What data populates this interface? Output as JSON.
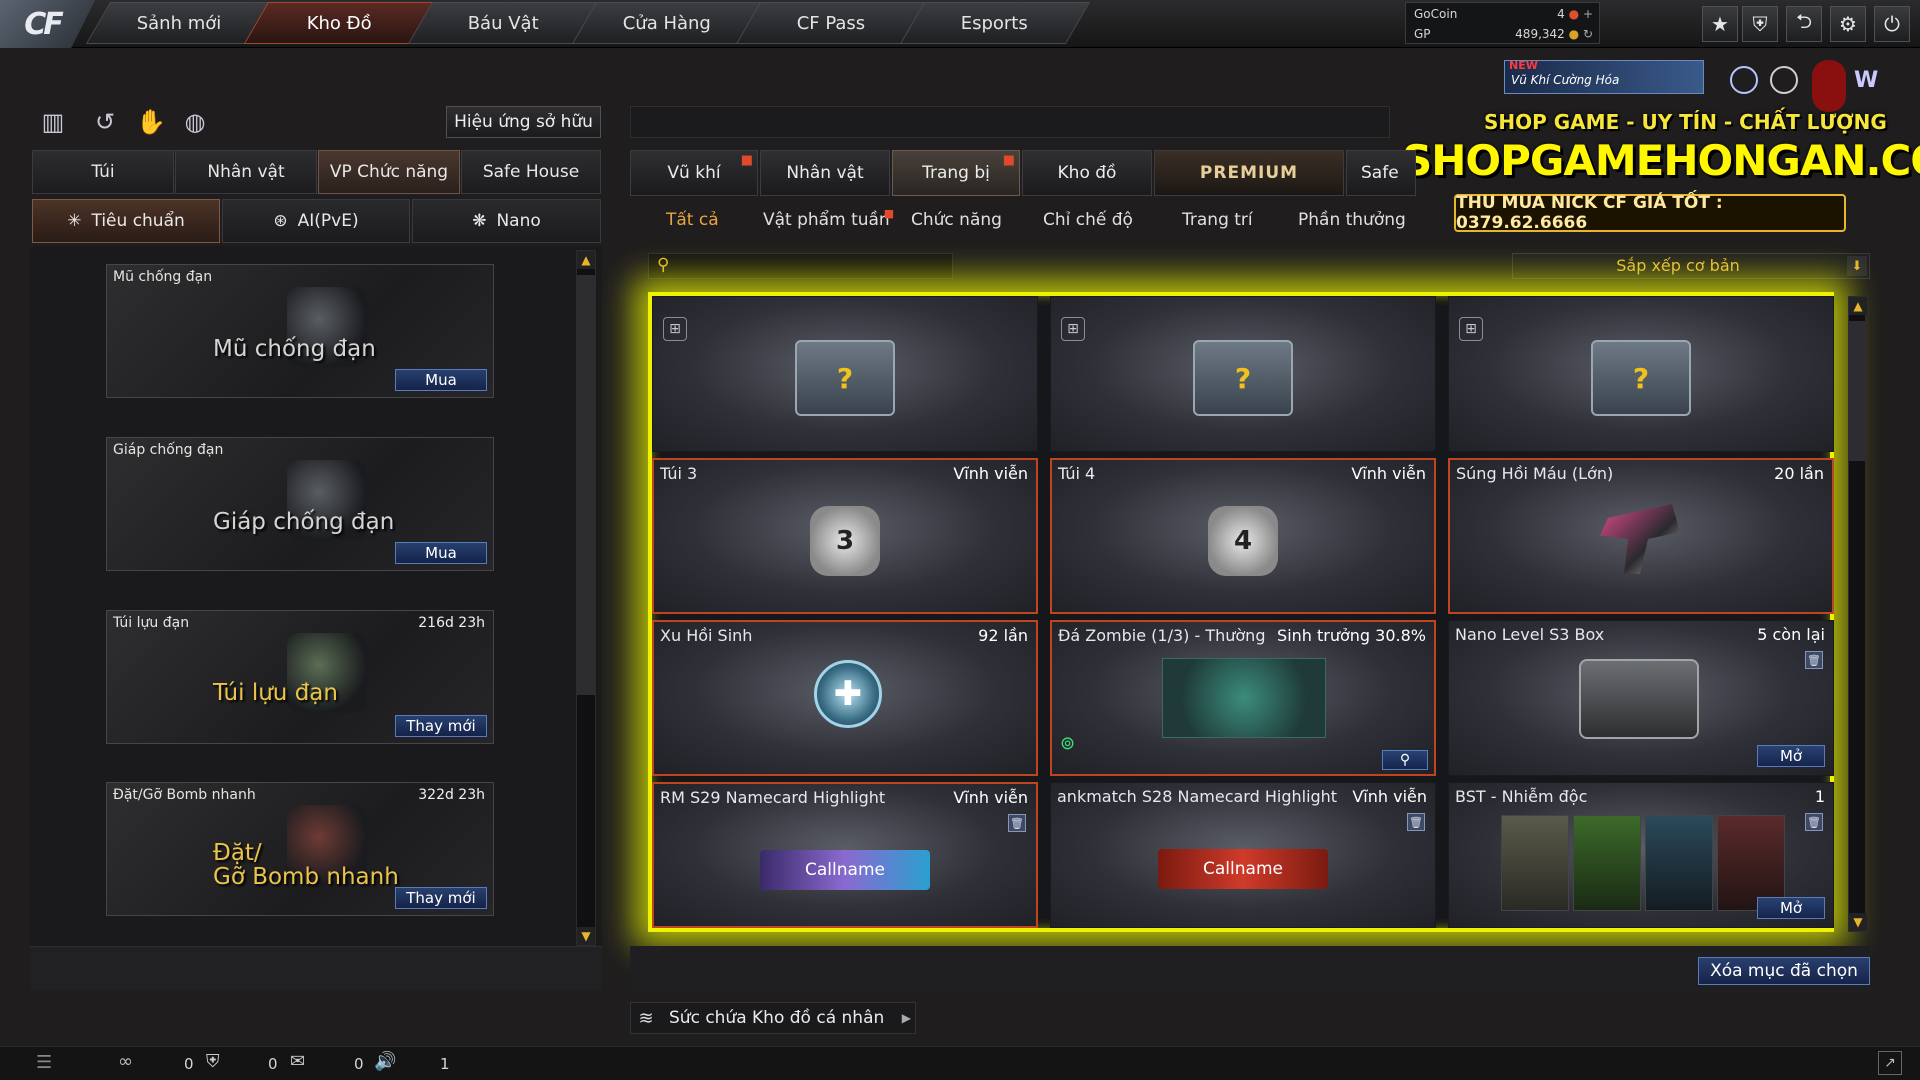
{
  "logo": "CF",
  "nav": [
    {
      "label": "Sảnh mới"
    },
    {
      "label": "Kho Đồ"
    },
    {
      "label": "Báu Vật"
    },
    {
      "label": "Cửa Hàng"
    },
    {
      "label": "CF Pass"
    },
    {
      "label": "Esports"
    }
  ],
  "currency": {
    "gocoin_label": "GoCoin",
    "gocoin_value": "4",
    "gp_label": "GP",
    "gp_value": "489,342"
  },
  "banner": {
    "new": "NEW",
    "weapon": "Vũ Khí Cường Hóa",
    "tagline": "SHOP GAME - UY TÍN - CHẤT LƯỢNG",
    "site": "SHOPGAMEHONGAN.COM",
    "phone": "THU MUA NICK CF GIÁ TỐT : 0379.62.6666"
  },
  "left": {
    "effect_button": "Hiệu ứng sở hữu",
    "tabs": [
      {
        "label": "Túi"
      },
      {
        "label": "Nhân vật"
      },
      {
        "label": "VP Chức năng"
      },
      {
        "label": "Safe House"
      }
    ],
    "subtabs": [
      {
        "label": "Tiêu chuẩn"
      },
      {
        "label": "AI(PvE)"
      },
      {
        "label": "Nano"
      }
    ],
    "slots": [
      {
        "name": "Mũ chống đạn",
        "time": "",
        "big": "Mũ chống đạn",
        "button": "Mua"
      },
      {
        "name": "Giáp chống đạn",
        "time": "",
        "big": "Giáp chống đạn",
        "button": "Mua"
      },
      {
        "name": "Túi lựu đạn",
        "time": "216d 23h",
        "big": "Túi lựu đạn",
        "button": "Thay mới"
      },
      {
        "name": "Đặt/Gỡ Bomb nhanh",
        "time": "322d 23h",
        "big1": "Đặt/",
        "big2": "Gỡ Bomb nhanh",
        "button": "Thay mới"
      }
    ]
  },
  "right": {
    "tabs": [
      {
        "label": "Vũ khí"
      },
      {
        "label": "Nhân vật"
      },
      {
        "label": "Trang bị"
      },
      {
        "label": "Kho đồ"
      },
      {
        "label": "PREMIUM"
      },
      {
        "label": "Safe"
      }
    ],
    "subtabs": [
      {
        "label": "Tất cả"
      },
      {
        "label": "Vật phẩm tuần"
      },
      {
        "label": "Chức năng"
      },
      {
        "label": "Chỉ chế độ"
      },
      {
        "label": "Trang trí"
      },
      {
        "label": "Phần thưởng"
      }
    ],
    "search_placeholder": "",
    "sort_label": "Sắp xếp cơ bản",
    "items": [
      {
        "name": "",
        "value": ""
      },
      {
        "name": "",
        "value": ""
      },
      {
        "name": "",
        "value": ""
      },
      {
        "name": "Túi 3",
        "value": "Vĩnh viễn",
        "badge": "3"
      },
      {
        "name": "Túi  4",
        "value": "Vĩnh viễn",
        "badge": "4"
      },
      {
        "name": "Súng Hồi Máu (Lớn)",
        "value": "20 lần"
      },
      {
        "name": "Xu Hồi Sinh",
        "value": "92 lần"
      },
      {
        "name": "Đá Zombie (1/3) - Thường",
        "value": "Sinh trưởng 30.8%"
      },
      {
        "name": "Nano Level S3 Box",
        "value": "5 còn lại",
        "button": "Mở"
      },
      {
        "name": "RM S29 Namecard Highlight",
        "value": "Vĩnh viễn",
        "callname": "Callname"
      },
      {
        "name": "ankmatch S28 Namecard Highlight",
        "value": "Vĩnh viễn",
        "callname": "Callname"
      },
      {
        "name": "BST - Nhiễm độc",
        "value": "1",
        "button": "Mở"
      }
    ],
    "delete_button": "Xóa mục đã chọn",
    "capacity": "Sức chứa Kho đồ cá nhân"
  },
  "statusbar": {
    "c1": "0",
    "c2": "0",
    "c3": "0",
    "c4": "1"
  }
}
